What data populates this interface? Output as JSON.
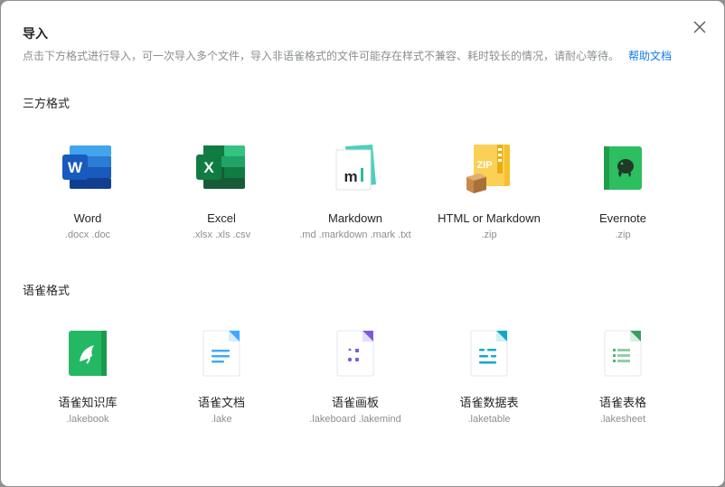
{
  "dialog": {
    "title": "导入",
    "description": "点击下方格式进行导入，可一次导入多个文件，导入非语雀格式的文件可能存在样式不兼容、耗时较长的情况，请耐心等待。",
    "help_link": "帮助文档"
  },
  "sections": [
    {
      "title": "三方格式",
      "items": [
        {
          "name": "Word",
          "ext": ".docx .doc",
          "icon": "word-icon"
        },
        {
          "name": "Excel",
          "ext": ".xlsx .xls .csv",
          "icon": "excel-icon"
        },
        {
          "name": "Markdown",
          "ext": ".md .markdown .mark .txt",
          "icon": "markdown-icon"
        },
        {
          "name": "HTML or Markdown",
          "ext": ".zip",
          "icon": "zip-icon"
        },
        {
          "name": "Evernote",
          "ext": ".zip",
          "icon": "evernote-icon"
        }
      ]
    },
    {
      "title": "语雀格式",
      "items": [
        {
          "name": "语雀知识库",
          "ext": ".lakebook",
          "icon": "lakebook-icon"
        },
        {
          "name": "语雀文档",
          "ext": ".lake",
          "icon": "lake-doc-icon"
        },
        {
          "name": "语雀画板",
          "ext": ".lakeboard .lakemind",
          "icon": "lakeboard-icon"
        },
        {
          "name": "语雀数据表",
          "ext": ".laketable",
          "icon": "laketable-icon"
        },
        {
          "name": "语雀表格",
          "ext": ".lakesheet",
          "icon": "lakesheet-icon"
        }
      ]
    }
  ],
  "colors": {
    "link": "#117cee",
    "word": "#2b579a",
    "excel": "#1e7145",
    "evernote": "#2dbe60",
    "lakebook": "#25b864"
  }
}
